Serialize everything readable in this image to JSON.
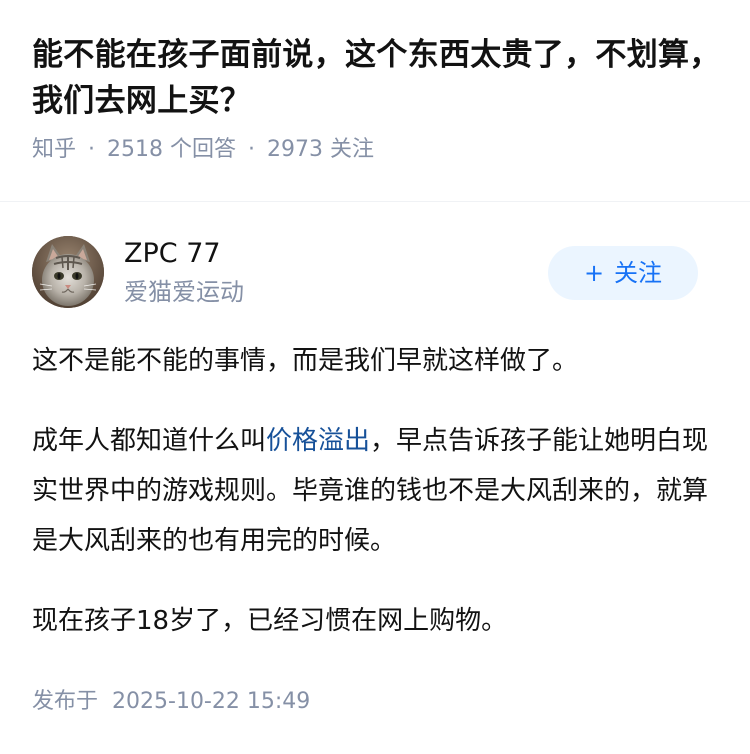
{
  "question": {
    "title": "能不能在孩子面前说，这个东西太贵了，不划算，我们去网上买？",
    "source": "知乎",
    "answers_count": "2518",
    "answers_label": "个回答",
    "followers_count": "2973",
    "followers_label": "关注"
  },
  "author": {
    "name": "ZPC 77",
    "bio": "爱猫爱运动",
    "avatar_icon": "cat-avatar",
    "follow_label": "关注",
    "follow_icon": "plus-icon"
  },
  "answer": {
    "p1": "这不是能不能的事情，而是我们早就这样做了。",
    "p2_before": "成年人都知道什么叫",
    "p2_link": "价格溢出",
    "p2_after": "，早点告诉孩子能让她明白现实世界中的游戏规则。毕竟谁的钱也不是大风刮来的，就算是大风刮来的也有用完的时候。",
    "p3": "现在孩子18岁了，已经习惯在网上购物。",
    "published_label": "发布于",
    "published_time": "2025-10-22 15:49"
  },
  "colors": {
    "link": "#175199",
    "meta_gray": "#8590a6",
    "follow_bg": "#ebf5ff",
    "follow_text": "#1772f6"
  }
}
